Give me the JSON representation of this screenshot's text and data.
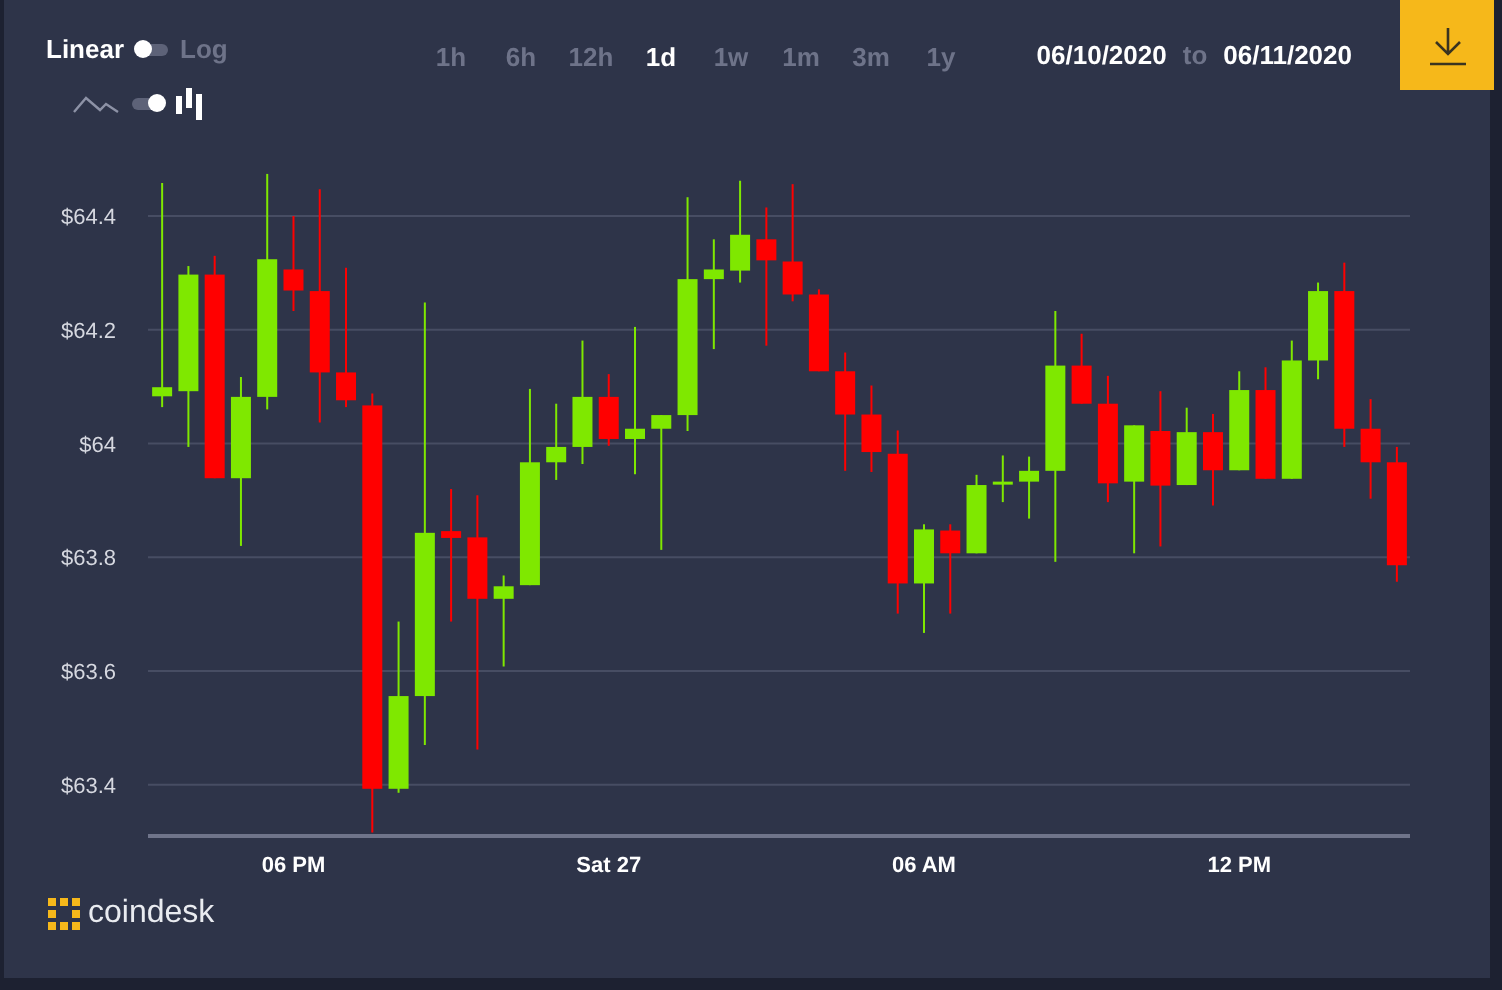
{
  "scale_toggle": {
    "options": [
      {
        "label": "Linear",
        "selected": true
      },
      {
        "label": "Log",
        "selected": false
      }
    ]
  },
  "chart_type_toggle": {
    "candles": true
  },
  "timeframes": [
    {
      "label": "1h",
      "selected": false
    },
    {
      "label": "6h",
      "selected": false
    },
    {
      "label": "12h",
      "selected": false
    },
    {
      "label": "1d",
      "selected": true
    },
    {
      "label": "1w",
      "selected": false
    },
    {
      "label": "1m",
      "selected": false
    },
    {
      "label": "3m",
      "selected": false
    },
    {
      "label": "1y",
      "selected": false
    }
  ],
  "date_range": {
    "from": "06/10/2020",
    "separator": "to",
    "to": "06/11/2020"
  },
  "chart": {
    "chart_data": {
      "type": "candlestick",
      "grid": true,
      "categories": [
        null,
        null,
        null,
        null,
        null,
        "06 PM",
        null,
        null,
        null,
        null,
        null,
        null,
        null,
        null,
        null,
        null,
        null,
        "Sat 27",
        null,
        null,
        null,
        null,
        null,
        null,
        null,
        null,
        null,
        null,
        null,
        "06 AM",
        null,
        null,
        null,
        null,
        null,
        null,
        null,
        null,
        null,
        null,
        null,
        "12 PM",
        null,
        null,
        null,
        null,
        null,
        null
      ],
      "ylim": [
        63.31,
        64.4
      ],
      "yticks": [
        {
          "value": 64.4,
          "label": "$64.4"
        },
        {
          "value": 64.2,
          "label": "$64.2"
        },
        {
          "value": 64,
          "label": "$64"
        },
        {
          "value": 63.8,
          "label": "$63.8"
        },
        {
          "value": 63.6,
          "label": "$63.6"
        },
        {
          "value": 63.4,
          "label": "$63.4"
        }
      ],
      "ohlc": [
        [
          64.083,
          64.458,
          64.064,
          64.099
        ],
        [
          64.092,
          64.312,
          63.994,
          64.297
        ],
        [
          64.297,
          64.33,
          63.939,
          63.939
        ],
        [
          63.939,
          64.117,
          63.82,
          64.082
        ],
        [
          64.082,
          64.474,
          64.06,
          64.324
        ],
        [
          64.306,
          64.4,
          64.233,
          64.269
        ],
        [
          64.268,
          64.447,
          64.037,
          64.125
        ],
        [
          64.125,
          64.309,
          64.064,
          64.076
        ],
        [
          64.067,
          64.088,
          63.316,
          63.393
        ],
        [
          63.393,
          63.687,
          63.386,
          63.556
        ],
        [
          63.556,
          64.248,
          63.47,
          63.843
        ],
        [
          63.846,
          63.92,
          63.687,
          63.834
        ],
        [
          63.835,
          63.909,
          63.462,
          63.727
        ],
        [
          63.727,
          63.768,
          63.608,
          63.749
        ],
        [
          63.751,
          64.096,
          63.751,
          63.967
        ],
        [
          63.967,
          64.07,
          63.936,
          63.994
        ],
        [
          63.994,
          64.181,
          63.964,
          64.082
        ],
        [
          64.082,
          64.122,
          63.996,
          64.008
        ],
        [
          64.008,
          64.205,
          63.946,
          64.026
        ],
        [
          64.026,
          64.05,
          63.813,
          64.05
        ],
        [
          64.05,
          64.433,
          64.022,
          64.289
        ],
        [
          64.289,
          64.359,
          64.166,
          64.306
        ],
        [
          64.304,
          64.462,
          64.283,
          64.367
        ],
        [
          64.359,
          64.415,
          64.172,
          64.322
        ],
        [
          64.32,
          64.456,
          64.25,
          64.262
        ],
        [
          64.262,
          64.271,
          64.127,
          64.127
        ],
        [
          64.127,
          64.16,
          63.952,
          64.051
        ],
        [
          64.051,
          64.102,
          63.95,
          63.985
        ],
        [
          63.982,
          64.023,
          63.701,
          63.754
        ],
        [
          63.754,
          63.858,
          63.667,
          63.849
        ],
        [
          63.847,
          63.858,
          63.701,
          63.807
        ],
        [
          63.807,
          63.945,
          63.807,
          63.927
        ],
        [
          63.932,
          63.979,
          63.897,
          63.933
        ],
        [
          63.933,
          63.977,
          63.868,
          63.952
        ],
        [
          63.952,
          64.233,
          63.792,
          64.137
        ],
        [
          64.137,
          64.193,
          64.07,
          64.07
        ],
        [
          64.07,
          64.119,
          63.897,
          63.93
        ],
        [
          63.933,
          64.032,
          63.807,
          64.032
        ],
        [
          64.022,
          64.092,
          63.819,
          63.926
        ],
        [
          63.927,
          64.063,
          63.927,
          64.02
        ],
        [
          64.02,
          64.052,
          63.891,
          63.953
        ],
        [
          63.953,
          64.127,
          63.953,
          64.094
        ],
        [
          64.094,
          64.134,
          63.938,
          63.938
        ],
        [
          63.938,
          64.181,
          63.938,
          64.146
        ],
        [
          64.146,
          64.283,
          64.113,
          64.268
        ],
        [
          64.268,
          64.318,
          63.994,
          64.026
        ],
        [
          64.026,
          64.078,
          63.903,
          63.967
        ],
        [
          63.967,
          63.994,
          63.757,
          63.786
        ]
      ]
    }
  },
  "logo": {
    "text": "coindesk"
  }
}
